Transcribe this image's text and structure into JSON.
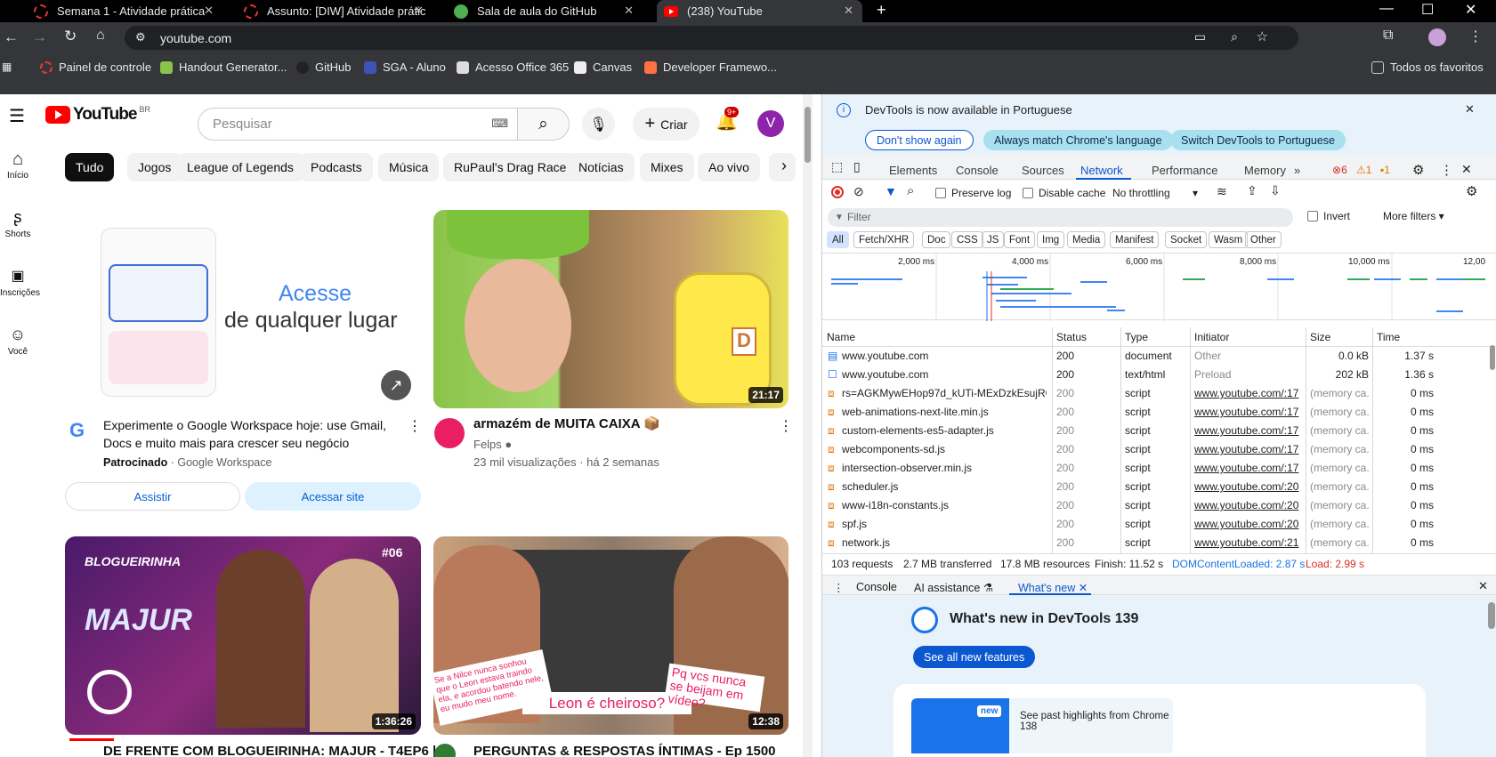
{
  "browser": {
    "tabs": [
      {
        "title": "Semana 1 - Atividade prática",
        "icon": "loading-icon"
      },
      {
        "title": "Assunto: [DIW] Atividade prátic",
        "icon": "loading-icon"
      },
      {
        "title": "Sala de aula do GitHub",
        "icon": "github-icon"
      },
      {
        "title": "(238) YouTube",
        "icon": "youtube-icon"
      }
    ],
    "url": "youtube.com",
    "bookmarks": [
      "Painel de controle",
      "Handout Generator...",
      "GitHub",
      "SGA - Aluno",
      "Acesso Office 365",
      "Canvas",
      "Developer Framewo..."
    ],
    "all_bookmarks": "Todos os favoritos"
  },
  "youtube": {
    "logo_text": "YouTube",
    "region": "BR",
    "search_placeholder": "Pesquisar",
    "create_label": "Criar",
    "notif_count": "9+",
    "avatar_letter": "V",
    "nav": [
      "Início",
      "Shorts",
      "Inscrições",
      "Você"
    ],
    "chips": [
      "Tudo",
      "Jogos",
      "League of Legends",
      "Podcasts",
      "Música",
      "RuPaul's Drag Race",
      "Notícias",
      "Mixes",
      "Ao vivo"
    ],
    "ad": {
      "headline1": "Acesse",
      "headline2": "de qualquer lugar",
      "title": "Experimente o Google Workspace hoje: use Gmail, Docs e muito mais para crescer seu negócio",
      "sponsored": "Patrocinado",
      "advertiser": "· Google Workspace",
      "btn_watch": "Assistir",
      "btn_visit": "Acessar site"
    },
    "video1": {
      "title": "armazém de MUITA CAIXA 📦",
      "channel": "Felps",
      "meta": "23 mil visualizações · há 2 semanas",
      "duration": "21:17"
    },
    "video2": {
      "duration": "1:36:26",
      "episode": "#06",
      "brand": "BLOGUEIRINHA",
      "name": "MAJUR",
      "title": "DE FRENTE COM BLOGUEIRINHA: MAJUR - T4EP6 |"
    },
    "video3": {
      "duration": "12:38",
      "caption1": "Pq vcs nunca se beijam em vídeo?",
      "caption2": "Leon é cheiroso?",
      "caption3": "Se a Nilce nunca sonhou que o Leon estava traindo ela, e acordou batendo nele, eu mudo meu nome.",
      "title": "PERGUNTAS & RESPOSTAS ÍNTIMAS - Ep 1500"
    }
  },
  "devtools": {
    "info": "DevTools is now available in Portuguese",
    "btn_dont_show": "Don't show again",
    "btn_match": "Always match Chrome's language",
    "btn_switch": "Switch DevTools to Portuguese",
    "tabs": [
      "Elements",
      "Console",
      "Sources",
      "Network",
      "Performance",
      "Memory"
    ],
    "errors": "6",
    "warnings": "1",
    "issues": "1",
    "preserve_log": "Preserve log",
    "disable_cache": "Disable cache",
    "throttling": "No throttling",
    "filter_placeholder": "Filter",
    "invert": "Invert",
    "more_filters": "More filters",
    "types": [
      "All",
      "Fetch/XHR",
      "Doc",
      "CSS",
      "JS",
      "Font",
      "Img",
      "Media",
      "Manifest",
      "Socket",
      "Wasm",
      "Other"
    ],
    "timeline": [
      "2,000 ms",
      "4,000 ms",
      "6,000 ms",
      "8,000 ms",
      "10,000 ms",
      "12,00"
    ],
    "columns": [
      "Name",
      "Status",
      "Type",
      "Initiator",
      "Size",
      "Time"
    ],
    "rows": [
      {
        "name": "www.youtube.com",
        "status": "200",
        "type": "document",
        "initiator": "Other",
        "size": "0.0 kB",
        "time": "1.37 s"
      },
      {
        "name": "www.youtube.com",
        "status": "200",
        "type": "text/html",
        "initiator": "Preload",
        "size": "202 kB",
        "time": "1.36 s"
      },
      {
        "name": "rs=AGKMywEHop97d_kUTi-MExDzkEsujRGz...",
        "status": "200",
        "type": "script",
        "initiator": "www.youtube.com/:17",
        "size": "(memory ca...",
        "time": "0 ms"
      },
      {
        "name": "web-animations-next-lite.min.js",
        "status": "200",
        "type": "script",
        "initiator": "www.youtube.com/:17",
        "size": "(memory ca...",
        "time": "0 ms"
      },
      {
        "name": "custom-elements-es5-adapter.js",
        "status": "200",
        "type": "script",
        "initiator": "www.youtube.com/:17",
        "size": "(memory ca...",
        "time": "0 ms"
      },
      {
        "name": "webcomponents-sd.js",
        "status": "200",
        "type": "script",
        "initiator": "www.youtube.com/:17",
        "size": "(memory ca...",
        "time": "0 ms"
      },
      {
        "name": "intersection-observer.min.js",
        "status": "200",
        "type": "script",
        "initiator": "www.youtube.com/:17",
        "size": "(memory ca...",
        "time": "0 ms"
      },
      {
        "name": "scheduler.js",
        "status": "200",
        "type": "script",
        "initiator": "www.youtube.com/:20",
        "size": "(memory ca...",
        "time": "0 ms"
      },
      {
        "name": "www-i18n-constants.js",
        "status": "200",
        "type": "script",
        "initiator": "www.youtube.com/:20",
        "size": "(memory ca...",
        "time": "0 ms"
      },
      {
        "name": "spf.js",
        "status": "200",
        "type": "script",
        "initiator": "www.youtube.com/:20",
        "size": "(memory ca...",
        "time": "0 ms"
      },
      {
        "name": "network.js",
        "status": "200",
        "type": "script",
        "initiator": "www.youtube.com/:21",
        "size": "(memory ca...",
        "time": "0 ms"
      }
    ],
    "summary": {
      "requests": "103 requests",
      "transferred": "2.7 MB transferred",
      "resources": "17.8 MB resources",
      "finish": "Finish: 11.52 s",
      "dcl": "DOMContentLoaded: 2.87 s",
      "load": "Load: 2.99 s"
    },
    "drawer_tabs": [
      "Console",
      "AI assistance",
      "What's new"
    ],
    "whatsnew_title": "What's new in DevTools 139",
    "see_all": "See all new features",
    "new_badge": "new",
    "past_highlights": "See past highlights from Chrome 138"
  }
}
